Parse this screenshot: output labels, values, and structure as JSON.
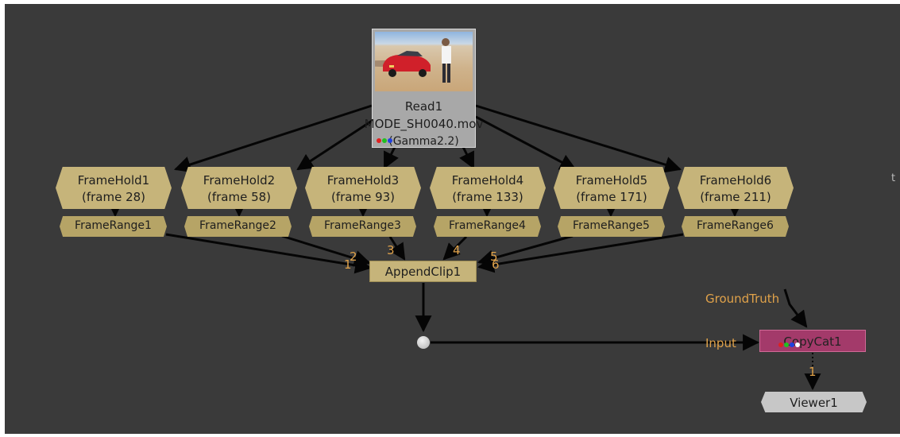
{
  "read_node": {
    "title": "Read1",
    "filename": "MODE_SH0040.mov",
    "colorspace": "(Gamma2.2)"
  },
  "frame_holds": [
    {
      "name": "FrameHold1",
      "frame": "(frame 28)"
    },
    {
      "name": "FrameHold2",
      "frame": "(frame 58)"
    },
    {
      "name": "FrameHold3",
      "frame": "(frame 93)"
    },
    {
      "name": "FrameHold4",
      "frame": "(frame 133)"
    },
    {
      "name": "FrameHold5",
      "frame": "(frame 171)"
    },
    {
      "name": "FrameHold6",
      "frame": "(frame 211)"
    }
  ],
  "frame_ranges": [
    {
      "name": "FrameRange1"
    },
    {
      "name": "FrameRange2"
    },
    {
      "name": "FrameRange3"
    },
    {
      "name": "FrameRange4"
    },
    {
      "name": "FrameRange5"
    },
    {
      "name": "FrameRange6"
    }
  ],
  "append_clip": {
    "name": "AppendClip1",
    "input_numbers": [
      "1",
      "2",
      "3",
      "4",
      "5",
      "6"
    ]
  },
  "copycat": {
    "name": "CopyCat1",
    "input_label": "Input",
    "groundtruth_label": "GroundTruth",
    "output_number": "1"
  },
  "viewer": {
    "name": "Viewer1"
  },
  "offscreen_text": "t",
  "colors": {
    "canvas_bg": "#3a3a3a",
    "frame_node": "#c6b47a",
    "copycat_node": "#a33a6a",
    "viewer_node": "#c7c7c7",
    "port_label": "#e0a24a",
    "wire": "#050505"
  }
}
